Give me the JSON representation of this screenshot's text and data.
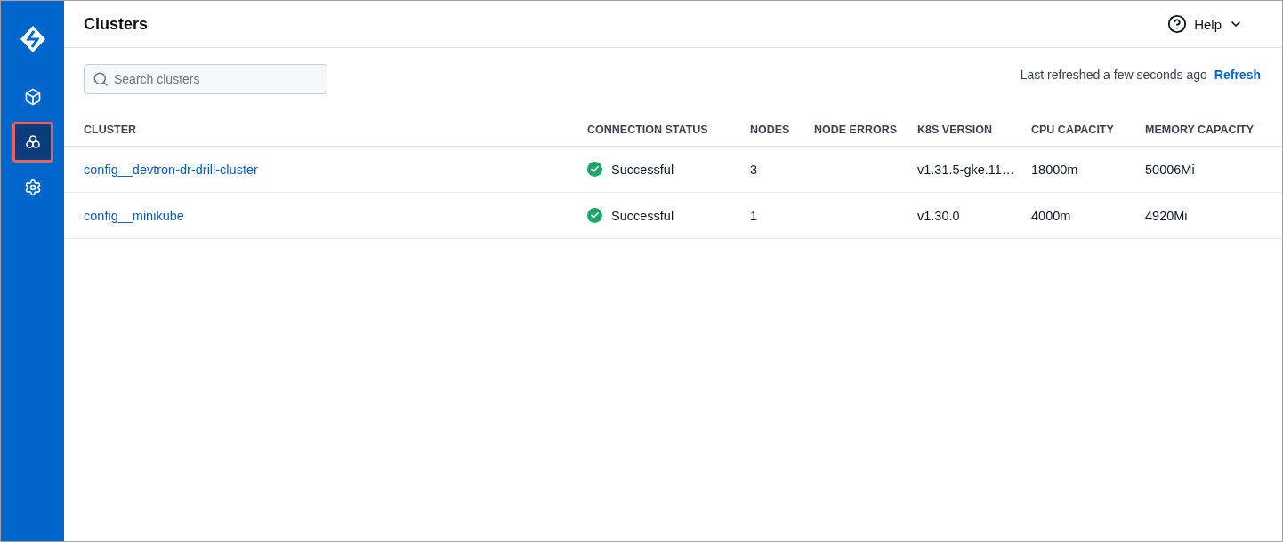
{
  "sidebar": {
    "items": [
      {
        "kind": "cube",
        "selected": false,
        "highlighted": false
      },
      {
        "kind": "clusters",
        "selected": true,
        "highlighted": true
      },
      {
        "kind": "settings",
        "selected": false,
        "highlighted": false
      }
    ]
  },
  "header": {
    "title": "Clusters",
    "help": "Help"
  },
  "search": {
    "placeholder": "Search clusters"
  },
  "refresh": {
    "status": "Last refreshed a few seconds ago",
    "action": "Refresh"
  },
  "table": {
    "columns": [
      "CLUSTER",
      "CONNECTION STATUS",
      "NODES",
      "NODE ERRORS",
      "K8S VERSION",
      "CPU CAPACITY",
      "MEMORY CAPACITY"
    ],
    "rows": [
      {
        "name": "config__devtron-dr-drill-cluster",
        "status": {
          "kind": "success",
          "label": "Successful"
        },
        "nodes": "3",
        "version": "v1.31.5-gke.11…",
        "cpu": "18000m",
        "memory": "50006Mi"
      },
      {
        "name": "config__minikube",
        "status": {
          "kind": "success",
          "label": "Successful"
        },
        "nodes": "1",
        "version": "v1.30.0",
        "cpu": "4000m",
        "memory": "4920Mi"
      }
    ]
  }
}
